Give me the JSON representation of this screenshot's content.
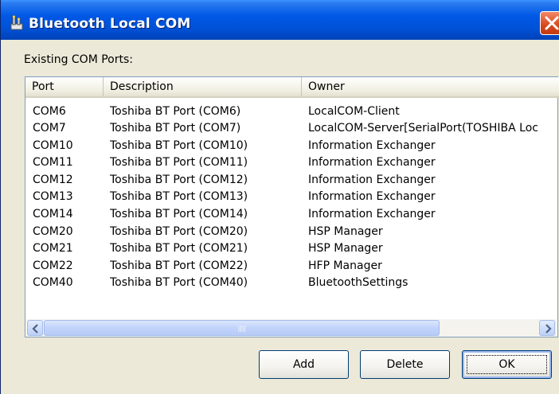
{
  "window": {
    "title": "Bluetooth Local COM"
  },
  "label": "Existing COM Ports:",
  "list": {
    "columns": [
      "Port",
      "Description",
      "Owner"
    ],
    "rows": [
      {
        "port": "COM6",
        "description": "Toshiba BT Port (COM6)",
        "owner": "LocalCOM-Client"
      },
      {
        "port": "COM7",
        "description": "Toshiba BT Port (COM7)",
        "owner": "LocalCOM-Server[SerialPort(TOSHIBA Loc"
      },
      {
        "port": "COM10",
        "description": "Toshiba BT Port (COM10)",
        "owner": "Information Exchanger"
      },
      {
        "port": "COM11",
        "description": "Toshiba BT Port (COM11)",
        "owner": "Information Exchanger"
      },
      {
        "port": "COM12",
        "description": "Toshiba BT Port (COM12)",
        "owner": "Information Exchanger"
      },
      {
        "port": "COM13",
        "description": "Toshiba BT Port (COM13)",
        "owner": "Information Exchanger"
      },
      {
        "port": "COM14",
        "description": "Toshiba BT Port (COM14)",
        "owner": "Information Exchanger"
      },
      {
        "port": "COM20",
        "description": "Toshiba BT Port (COM20)",
        "owner": "HSP Manager"
      },
      {
        "port": "COM21",
        "description": "Toshiba BT Port (COM21)",
        "owner": "HSP Manager"
      },
      {
        "port": "COM22",
        "description": "Toshiba BT Port (COM22)",
        "owner": "HFP Manager"
      },
      {
        "port": "COM40",
        "description": "Toshiba BT Port (COM40)",
        "owner": "BluetoothSettings"
      }
    ]
  },
  "buttons": {
    "add": "Add",
    "delete": "Delete",
    "ok": "OK"
  },
  "icons": {
    "title": "bluetooth-settings-icon",
    "close": "close-icon",
    "scroll_left": "arrow-left-icon",
    "scroll_right": "arrow-right-icon"
  },
  "colors": {
    "titlebar": "#0058e6",
    "close": "#d9471c",
    "dialog": "#ece9d8"
  }
}
